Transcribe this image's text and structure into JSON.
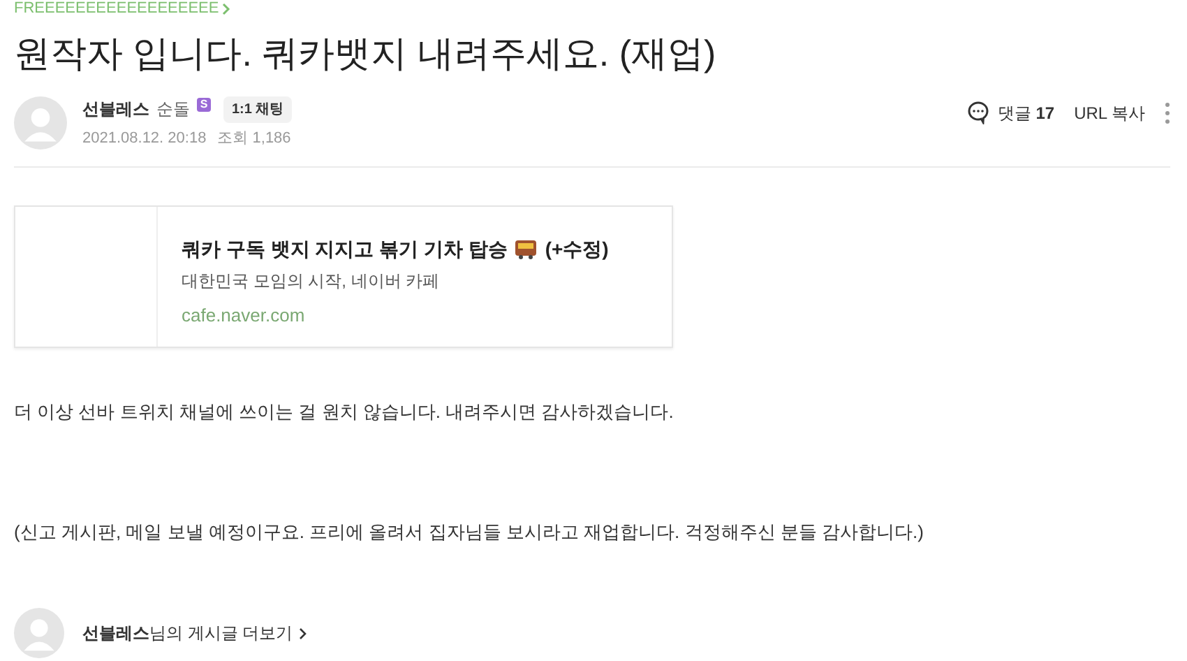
{
  "board": {
    "name": "FREEEEEEEEEEEEEEEEEE"
  },
  "post": {
    "title": "원작자 입니다. 쿼카뱃지 내려주세요. (재업)"
  },
  "author": {
    "nickname": "선블레스",
    "rank": "순돌",
    "rank_badge": "S",
    "chat_button": "1:1 채팅",
    "date": "2021.08.12. 20:18",
    "views_label": "조회",
    "views": "1,186"
  },
  "actions": {
    "comments_label": "댓글",
    "comments": "17",
    "copy_url": "URL 복사"
  },
  "link_card": {
    "title": "쿼카 구독 뱃지 지지고 볶기 기차 탑승",
    "title_suffix": "(+수정)",
    "description": "대한민국 모임의 시작, 네이버 카페",
    "url": "cafe.naver.com"
  },
  "body": [
    "더 이상 선바 트위치 채널에 쓰이는 걸 원치 않습니다. 내려주시면 감사하겠습니다.",
    "(신고 게시판, 메일 보낼 예정이구요. 프리에 올려서 집자님들 보시라고 재업합니다. 걱정해주신 분들 감사합니다.)"
  ],
  "footer": {
    "more_posts": "**선블레스**님의 게시글 더보기"
  }
}
